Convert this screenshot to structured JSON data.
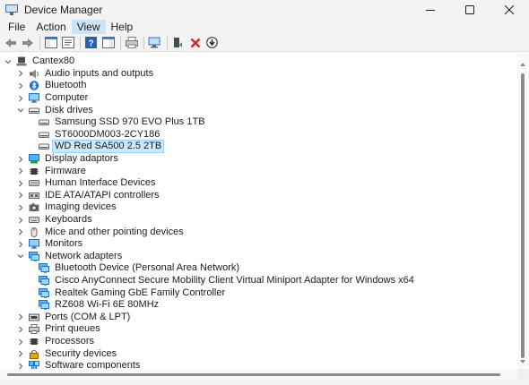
{
  "window": {
    "title": "Device Manager"
  },
  "menu": [
    "File",
    "Action",
    "View",
    "Help"
  ],
  "menu_active": "View",
  "toolbar": [
    "back-icon",
    "forward-icon",
    "show-hide-console-tree-icon",
    "properties-icon",
    "help-icon",
    "show-hide-action-pane-icon",
    "print-icon",
    "scan-hardware-changes-icon",
    "update-driver-icon",
    "uninstall-device-icon",
    "disable-device-icon"
  ],
  "tree": [
    {
      "label": "Cantex80",
      "level": 0,
      "state": "open",
      "icon": "computer-root-icon"
    },
    {
      "label": "Audio inputs and outputs",
      "level": 1,
      "state": "closed",
      "icon": "speaker-icon"
    },
    {
      "label": "Bluetooth",
      "level": 1,
      "state": "closed",
      "icon": "bluetooth-icon"
    },
    {
      "label": "Computer",
      "level": 1,
      "state": "closed",
      "icon": "monitor-icon"
    },
    {
      "label": "Disk drives",
      "level": 1,
      "state": "open",
      "icon": "disk-icon"
    },
    {
      "label": "Samsung SSD 970 EVO Plus 1TB",
      "level": 2,
      "state": "leaf",
      "icon": "disk-icon"
    },
    {
      "label": "ST6000DM003-2CY186",
      "level": 2,
      "state": "leaf",
      "icon": "disk-icon"
    },
    {
      "label": "WD Red SA500 2.5 2TB",
      "level": 2,
      "state": "leaf",
      "icon": "disk-icon",
      "selected": true
    },
    {
      "label": "Display adaptors",
      "level": 1,
      "state": "closed",
      "icon": "display-adapter-icon"
    },
    {
      "label": "Firmware",
      "level": 1,
      "state": "closed",
      "icon": "chip-icon"
    },
    {
      "label": "Human Interface Devices",
      "level": 1,
      "state": "closed",
      "icon": "hid-icon"
    },
    {
      "label": "IDE ATA/ATAPI controllers",
      "level": 1,
      "state": "closed",
      "icon": "controller-icon"
    },
    {
      "label": "Imaging devices",
      "level": 1,
      "state": "closed",
      "icon": "camera-icon"
    },
    {
      "label": "Keyboards",
      "level": 1,
      "state": "closed",
      "icon": "keyboard-icon"
    },
    {
      "label": "Mice and other pointing devices",
      "level": 1,
      "state": "closed",
      "icon": "mouse-icon"
    },
    {
      "label": "Monitors",
      "level": 1,
      "state": "closed",
      "icon": "monitor-icon"
    },
    {
      "label": "Network adapters",
      "level": 1,
      "state": "open",
      "icon": "network-icon"
    },
    {
      "label": "Bluetooth Device (Personal Area Network)",
      "level": 2,
      "state": "leaf",
      "icon": "network-icon"
    },
    {
      "label": "Cisco AnyConnect Secure Mobility Client Virtual Miniport Adapter for Windows x64",
      "level": 2,
      "state": "leaf",
      "icon": "network-icon"
    },
    {
      "label": "Realtek Gaming GbE Family Controller",
      "level": 2,
      "state": "leaf",
      "icon": "network-icon"
    },
    {
      "label": "RZ608 Wi-Fi 6E 80MHz",
      "level": 2,
      "state": "leaf",
      "icon": "network-icon"
    },
    {
      "label": "Ports (COM & LPT)",
      "level": 1,
      "state": "closed",
      "icon": "port-icon"
    },
    {
      "label": "Print queues",
      "level": 1,
      "state": "closed",
      "icon": "printer-icon"
    },
    {
      "label": "Processors",
      "level": 1,
      "state": "closed",
      "icon": "chip-icon"
    },
    {
      "label": "Security devices",
      "level": 1,
      "state": "closed",
      "icon": "security-icon"
    },
    {
      "label": "Software components",
      "level": 1,
      "state": "closed",
      "icon": "component-icon"
    }
  ]
}
